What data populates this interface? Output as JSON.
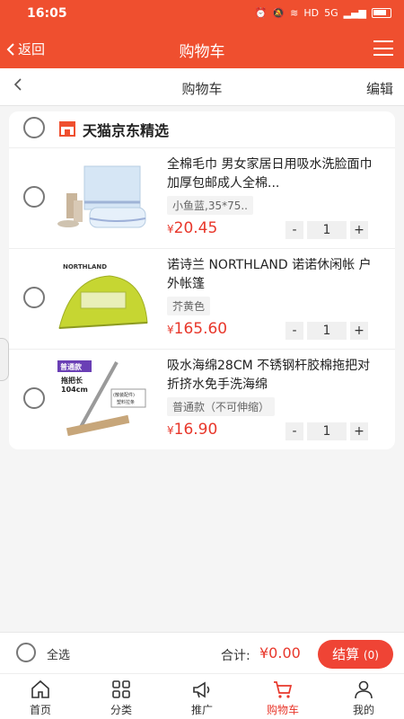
{
  "status": {
    "time": "16:05",
    "net": "HD",
    "signal": "5G"
  },
  "header": {
    "back_label": "返回",
    "title": "购物车"
  },
  "subheader": {
    "title": "购物车",
    "edit_label": "编辑"
  },
  "store": {
    "name": "天猫京东精选"
  },
  "items": [
    {
      "name": "全棉毛巾 男女家居日用吸水洗脸面巾加厚包邮成人全棉...",
      "spec": "小鱼蓝,35*75..",
      "currency": "¥",
      "price": "20.45",
      "qty": "1"
    },
    {
      "name": "诺诗兰 NORTHLAND 诺诺休闲帐 户外帐篷",
      "spec": "芥黄色",
      "currency": "¥",
      "price": "165.60",
      "qty": "1",
      "brand": "NORTHLAND"
    },
    {
      "name": "吸水海绵28CM 不锈钢杆胶棉拖把对折挤水免手洗海绵",
      "spec": "普通款（不可伸缩）",
      "currency": "¥",
      "price": "16.90",
      "qty": "1",
      "badge": "普通款",
      "mop_len": "拖把长",
      "mop_val": "104cm",
      "part_note": "(散装配件)",
      "part_name": "塑料拉条"
    }
  ],
  "stepper": {
    "minus": "-",
    "plus": "+"
  },
  "footer": {
    "select_all": "全选",
    "total_label": "合计:",
    "total": "¥0.00",
    "checkout": "结算",
    "checkout_count": "(0)"
  },
  "tabs": [
    {
      "label": "首页",
      "icon": "home-icon"
    },
    {
      "label": "分类",
      "icon": "grid-icon"
    },
    {
      "label": "推广",
      "icon": "megaphone-icon"
    },
    {
      "label": "购物车",
      "icon": "cart-icon",
      "active": true
    },
    {
      "label": "我的",
      "icon": "user-icon"
    }
  ],
  "colors": {
    "primary": "#ef4f2f",
    "price": "#e8372b",
    "checkout": "#ef4435"
  }
}
